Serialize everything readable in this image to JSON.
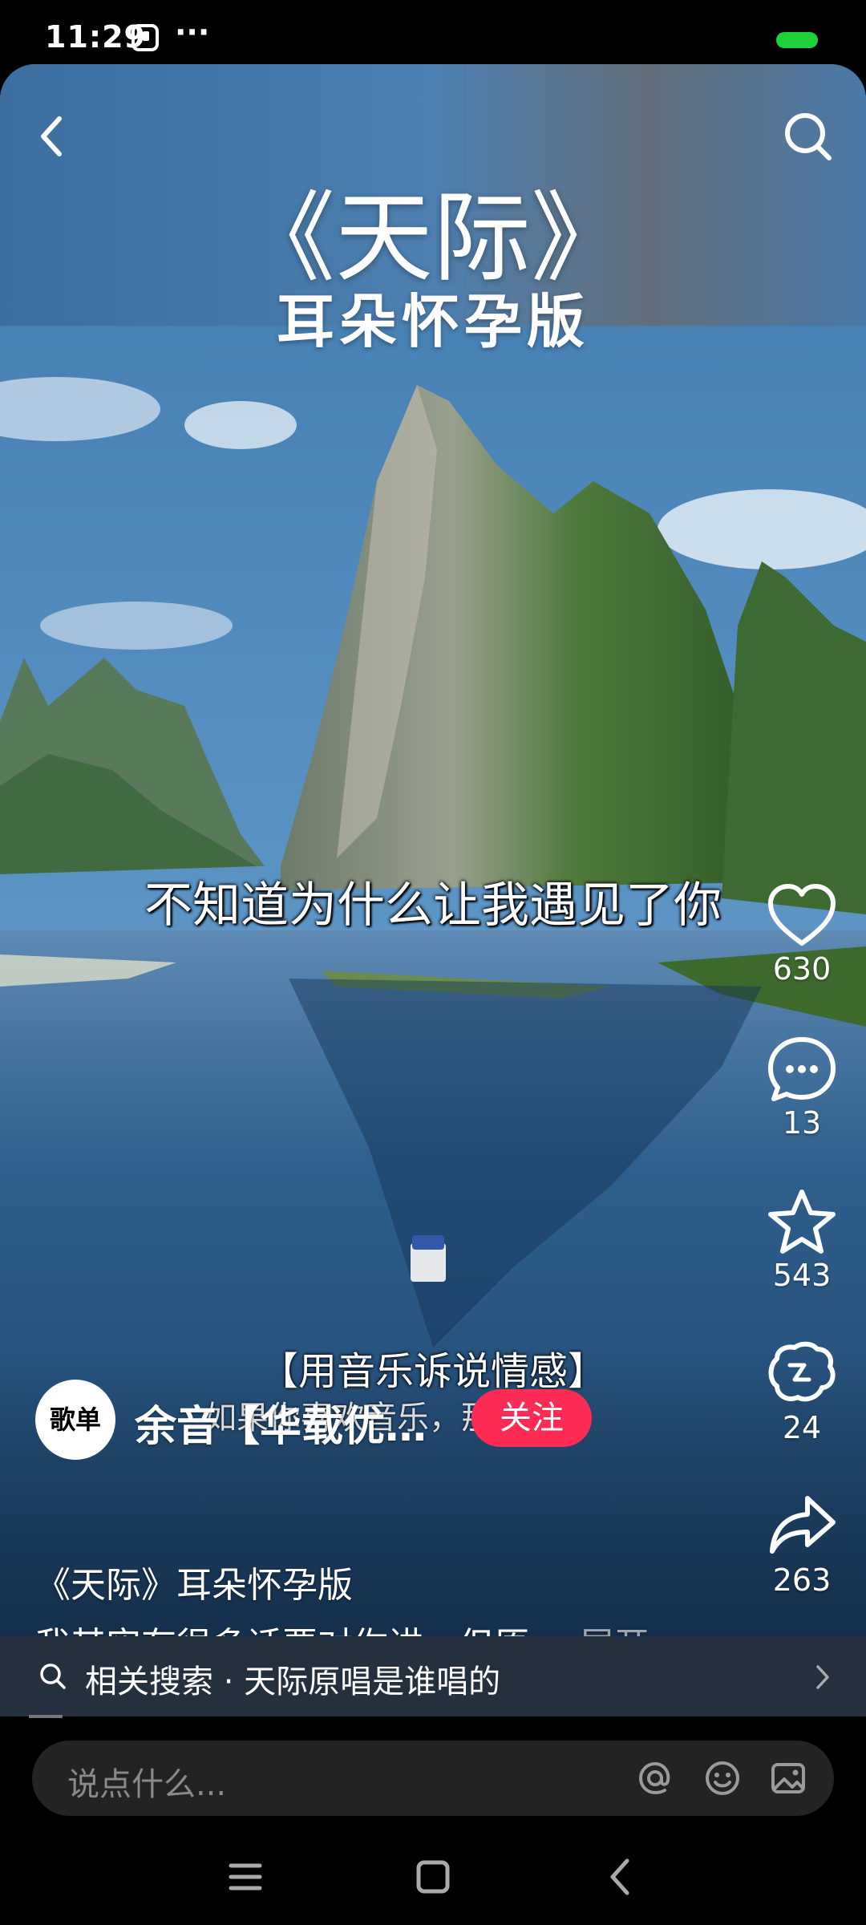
{
  "status": {
    "time": "11:29",
    "more": "···"
  },
  "video": {
    "title_main": "《天际》",
    "title_sub": "耳朵怀孕版",
    "lyric": "不知道为什么让我遇见了你",
    "tag": "【用音乐诉说情感】",
    "overlay_line": "如果你喜欢音乐，那么好有"
  },
  "actions": {
    "like_count": "630",
    "comment_count": "13",
    "favorite_count": "543",
    "repost_count": "24",
    "share_count": "263"
  },
  "author": {
    "avatar_text": "歌单",
    "name": "余音【华载优…",
    "follow_label": "关注"
  },
  "description": {
    "title": "《天际》耳朵怀孕版",
    "text": "我其实有很多话要对你讲，但原…",
    "expand_label": "展开"
  },
  "related_search": {
    "text": "相关搜索 · 天际原唱是谁唱的"
  },
  "comment_bar": {
    "placeholder": "说点什么..."
  },
  "colors": {
    "follow_red": "#fe2c55",
    "battery_green": "#1fd13a"
  },
  "icons": [
    "back-arrow-icon",
    "search-icon",
    "heart-icon",
    "comment-bubble-icon",
    "star-icon",
    "repost-icon",
    "share-arrow-icon",
    "at-icon",
    "emoji-icon",
    "image-icon",
    "menu-icon",
    "home-square-icon",
    "back-triangle-icon"
  ]
}
